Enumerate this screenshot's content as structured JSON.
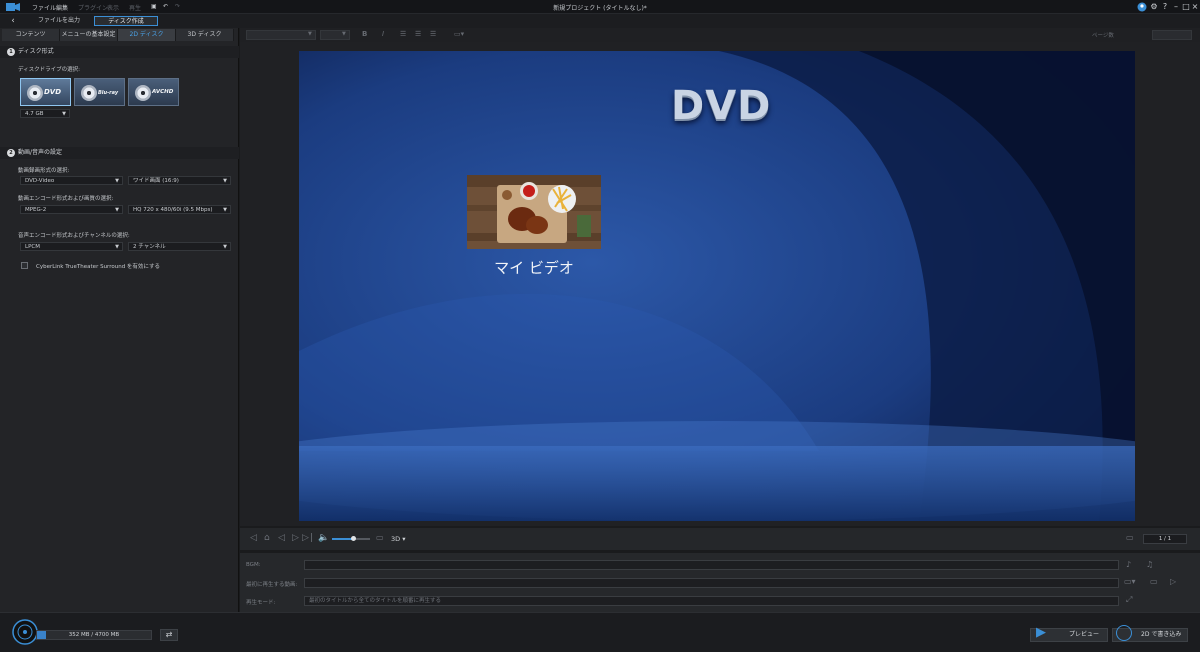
{
  "app": {
    "title": "新規プロジェクト (タイトルなし)*",
    "menus": [
      "ファイル",
      "編集",
      "プラグイン",
      "表示",
      "再生"
    ],
    "accent": "#3b8fd6"
  },
  "top_tabs": {
    "output_file": "ファイルを出力",
    "create_disc": "ディスク作成"
  },
  "sub_tabs": [
    "コンテンツ",
    "メニューの基本設定",
    "2D ディスク",
    "3D ディスク"
  ],
  "disc_format": {
    "heading": "ディスク形式",
    "drive_label": "ディスクドライブの選択:",
    "options": [
      "DVD",
      "Blu-ray",
      "AVCHD"
    ],
    "capacity": "4.7 GB"
  },
  "av_settings": {
    "heading": "動画/音声の設定",
    "video_format_label": "動画録画形式の選択:",
    "video_format": "DVD-Video",
    "aspect": "ワイド画面 (16:9)",
    "encode_label": "動画エンコード形式および画質の選択:",
    "encode": "MPEG-2",
    "quality": "HQ 720 x 480/60i (9.5 Mbps)",
    "audio_label": "音声エンコード形式およびチャンネルの選択:",
    "audio": "LPCM",
    "channels": "2 チャンネル",
    "surround": "CyberLink TrueTheater Surround を有効にする"
  },
  "toolbar": {
    "layers": "ページ数"
  },
  "menu_preview": {
    "title": "DVD",
    "video_label": "マイ ビデオ"
  },
  "playback": {
    "mode": "3D",
    "page": "1 / 1",
    "volume": 0.55
  },
  "settings": {
    "bgm_label": "BGM:",
    "first_play_label": "最初に再生する動画:",
    "play_mode_label": "再生モード:",
    "play_mode_value": "最初のタイトルから全てのタイトルを順番に再生する"
  },
  "footer": {
    "capacity_text": "352 MB / 4700 MB",
    "used_fraction": 0.075,
    "preview_label": "プレビュー",
    "burn_label": "2D で書き込み"
  }
}
